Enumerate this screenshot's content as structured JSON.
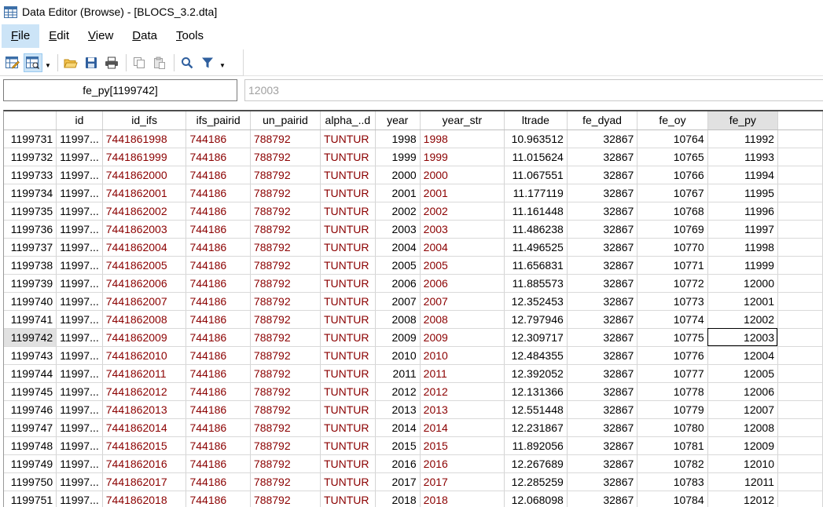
{
  "window": {
    "title": "Data Editor (Browse) - [BLOCS_3.2.dta]",
    "app_icon": "spreadsheet-icon"
  },
  "menu": [
    {
      "label": "File",
      "key": "F",
      "rest": "ile",
      "active": true
    },
    {
      "label": "Edit",
      "key": "E",
      "rest": "dit",
      "active": false
    },
    {
      "label": "View",
      "key": "V",
      "rest": "iew",
      "active": false
    },
    {
      "label": "Data",
      "key": "D",
      "rest": "ata",
      "active": false
    },
    {
      "label": "Tools",
      "key": "T",
      "rest": "ools",
      "active": false
    }
  ],
  "toolbar": {
    "icons": [
      "data-editor-edit-icon",
      "data-editor-browse-icon",
      "open-folder-icon",
      "save-icon",
      "print-icon",
      "copy-icon",
      "paste-icon",
      "find-icon",
      "filter-icon"
    ]
  },
  "varbar": {
    "cell_ref": "fe_py[1199742]",
    "cell_value": "12003"
  },
  "colors": {
    "string_text": "#8b0000",
    "selection": "#cce4f7",
    "frozen_divider": "#e02020"
  },
  "grid": {
    "columns": [
      {
        "key": "rownum",
        "label": "",
        "width": 67,
        "type": "rownum"
      },
      {
        "key": "id",
        "label": "id",
        "width": 53,
        "type": "id"
      },
      {
        "key": "id_ifs",
        "label": "id_ifs",
        "width": 108,
        "type": "str"
      },
      {
        "key": "ifs_pairid",
        "label": "ifs_pairid",
        "width": 83,
        "type": "str"
      },
      {
        "key": "un_pairid",
        "label": "un_pairid",
        "width": 91,
        "type": "str"
      },
      {
        "key": "alpha_d",
        "label": "alpha_..d",
        "width": 70,
        "type": "str"
      },
      {
        "key": "year",
        "label": "year",
        "width": 58,
        "type": "num"
      },
      {
        "key": "year_str",
        "label": "year_str",
        "width": 111,
        "type": "str",
        "frozen": true
      },
      {
        "key": "ltrade",
        "label": "ltrade",
        "width": 80,
        "type": "num"
      },
      {
        "key": "fe_dyad",
        "label": "fe_dyad",
        "width": 92,
        "type": "num"
      },
      {
        "key": "fe_oy",
        "label": "fe_oy",
        "width": 92,
        "type": "num"
      },
      {
        "key": "fe_py",
        "label": "fe_py",
        "width": 92,
        "type": "num",
        "selected": true
      },
      {
        "key": "extra",
        "label": "",
        "width": 60,
        "type": "blank"
      }
    ],
    "selected_row": "1199742",
    "selected_col": "fe_py",
    "rows": [
      {
        "rownum": "1199731",
        "id": "11997...",
        "id_ifs": "7441861998",
        "ifs_pairid": "744186",
        "un_pairid": "788792",
        "alpha_d": "TUNTUR",
        "year": "1998",
        "year_str": "1998",
        "ltrade": "10.963512",
        "fe_dyad": "32867",
        "fe_oy": "10764",
        "fe_py": "11992"
      },
      {
        "rownum": "1199732",
        "id": "11997...",
        "id_ifs": "7441861999",
        "ifs_pairid": "744186",
        "un_pairid": "788792",
        "alpha_d": "TUNTUR",
        "year": "1999",
        "year_str": "1999",
        "ltrade": "11.015624",
        "fe_dyad": "32867",
        "fe_oy": "10765",
        "fe_py": "11993"
      },
      {
        "rownum": "1199733",
        "id": "11997...",
        "id_ifs": "7441862000",
        "ifs_pairid": "744186",
        "un_pairid": "788792",
        "alpha_d": "TUNTUR",
        "year": "2000",
        "year_str": "2000",
        "ltrade": "11.067551",
        "fe_dyad": "32867",
        "fe_oy": "10766",
        "fe_py": "11994"
      },
      {
        "rownum": "1199734",
        "id": "11997...",
        "id_ifs": "7441862001",
        "ifs_pairid": "744186",
        "un_pairid": "788792",
        "alpha_d": "TUNTUR",
        "year": "2001",
        "year_str": "2001",
        "ltrade": "11.177119",
        "fe_dyad": "32867",
        "fe_oy": "10767",
        "fe_py": "11995"
      },
      {
        "rownum": "1199735",
        "id": "11997...",
        "id_ifs": "7441862002",
        "ifs_pairid": "744186",
        "un_pairid": "788792",
        "alpha_d": "TUNTUR",
        "year": "2002",
        "year_str": "2002",
        "ltrade": "11.161448",
        "fe_dyad": "32867",
        "fe_oy": "10768",
        "fe_py": "11996"
      },
      {
        "rownum": "1199736",
        "id": "11997...",
        "id_ifs": "7441862003",
        "ifs_pairid": "744186",
        "un_pairid": "788792",
        "alpha_d": "TUNTUR",
        "year": "2003",
        "year_str": "2003",
        "ltrade": "11.486238",
        "fe_dyad": "32867",
        "fe_oy": "10769",
        "fe_py": "11997"
      },
      {
        "rownum": "1199737",
        "id": "11997...",
        "id_ifs": "7441862004",
        "ifs_pairid": "744186",
        "un_pairid": "788792",
        "alpha_d": "TUNTUR",
        "year": "2004",
        "year_str": "2004",
        "ltrade": "11.496525",
        "fe_dyad": "32867",
        "fe_oy": "10770",
        "fe_py": "11998"
      },
      {
        "rownum": "1199738",
        "id": "11997...",
        "id_ifs": "7441862005",
        "ifs_pairid": "744186",
        "un_pairid": "788792",
        "alpha_d": "TUNTUR",
        "year": "2005",
        "year_str": "2005",
        "ltrade": "11.656831",
        "fe_dyad": "32867",
        "fe_oy": "10771",
        "fe_py": "11999"
      },
      {
        "rownum": "1199739",
        "id": "11997...",
        "id_ifs": "7441862006",
        "ifs_pairid": "744186",
        "un_pairid": "788792",
        "alpha_d": "TUNTUR",
        "year": "2006",
        "year_str": "2006",
        "ltrade": "11.885573",
        "fe_dyad": "32867",
        "fe_oy": "10772",
        "fe_py": "12000"
      },
      {
        "rownum": "1199740",
        "id": "11997...",
        "id_ifs": "7441862007",
        "ifs_pairid": "744186",
        "un_pairid": "788792",
        "alpha_d": "TUNTUR",
        "year": "2007",
        "year_str": "2007",
        "ltrade": "12.352453",
        "fe_dyad": "32867",
        "fe_oy": "10773",
        "fe_py": "12001"
      },
      {
        "rownum": "1199741",
        "id": "11997...",
        "id_ifs": "7441862008",
        "ifs_pairid": "744186",
        "un_pairid": "788792",
        "alpha_d": "TUNTUR",
        "year": "2008",
        "year_str": "2008",
        "ltrade": "12.797946",
        "fe_dyad": "32867",
        "fe_oy": "10774",
        "fe_py": "12002"
      },
      {
        "rownum": "1199742",
        "id": "11997...",
        "id_ifs": "7441862009",
        "ifs_pairid": "744186",
        "un_pairid": "788792",
        "alpha_d": "TUNTUR",
        "year": "2009",
        "year_str": "2009",
        "ltrade": "12.309717",
        "fe_dyad": "32867",
        "fe_oy": "10775",
        "fe_py": "12003"
      },
      {
        "rownum": "1199743",
        "id": "11997...",
        "id_ifs": "7441862010",
        "ifs_pairid": "744186",
        "un_pairid": "788792",
        "alpha_d": "TUNTUR",
        "year": "2010",
        "year_str": "2010",
        "ltrade": "12.484355",
        "fe_dyad": "32867",
        "fe_oy": "10776",
        "fe_py": "12004"
      },
      {
        "rownum": "1199744",
        "id": "11997...",
        "id_ifs": "7441862011",
        "ifs_pairid": "744186",
        "un_pairid": "788792",
        "alpha_d": "TUNTUR",
        "year": "2011",
        "year_str": "2011",
        "ltrade": "12.392052",
        "fe_dyad": "32867",
        "fe_oy": "10777",
        "fe_py": "12005"
      },
      {
        "rownum": "1199745",
        "id": "11997...",
        "id_ifs": "7441862012",
        "ifs_pairid": "744186",
        "un_pairid": "788792",
        "alpha_d": "TUNTUR",
        "year": "2012",
        "year_str": "2012",
        "ltrade": "12.131366",
        "fe_dyad": "32867",
        "fe_oy": "10778",
        "fe_py": "12006"
      },
      {
        "rownum": "1199746",
        "id": "11997...",
        "id_ifs": "7441862013",
        "ifs_pairid": "744186",
        "un_pairid": "788792",
        "alpha_d": "TUNTUR",
        "year": "2013",
        "year_str": "2013",
        "ltrade": "12.551448",
        "fe_dyad": "32867",
        "fe_oy": "10779",
        "fe_py": "12007"
      },
      {
        "rownum": "1199747",
        "id": "11997...",
        "id_ifs": "7441862014",
        "ifs_pairid": "744186",
        "un_pairid": "788792",
        "alpha_d": "TUNTUR",
        "year": "2014",
        "year_str": "2014",
        "ltrade": "12.231867",
        "fe_dyad": "32867",
        "fe_oy": "10780",
        "fe_py": "12008"
      },
      {
        "rownum": "1199748",
        "id": "11997...",
        "id_ifs": "7441862015",
        "ifs_pairid": "744186",
        "un_pairid": "788792",
        "alpha_d": "TUNTUR",
        "year": "2015",
        "year_str": "2015",
        "ltrade": "11.892056",
        "fe_dyad": "32867",
        "fe_oy": "10781",
        "fe_py": "12009"
      },
      {
        "rownum": "1199749",
        "id": "11997...",
        "id_ifs": "7441862016",
        "ifs_pairid": "744186",
        "un_pairid": "788792",
        "alpha_d": "TUNTUR",
        "year": "2016",
        "year_str": "2016",
        "ltrade": "12.267689",
        "fe_dyad": "32867",
        "fe_oy": "10782",
        "fe_py": "12010"
      },
      {
        "rownum": "1199750",
        "id": "11997...",
        "id_ifs": "7441862017",
        "ifs_pairid": "744186",
        "un_pairid": "788792",
        "alpha_d": "TUNTUR",
        "year": "2017",
        "year_str": "2017",
        "ltrade": "12.285259",
        "fe_dyad": "32867",
        "fe_oy": "10783",
        "fe_py": "12011"
      },
      {
        "rownum": "1199751",
        "id": "11997...",
        "id_ifs": "7441862018",
        "ifs_pairid": "744186",
        "un_pairid": "788792",
        "alpha_d": "TUNTUR",
        "year": "2018",
        "year_str": "2018",
        "ltrade": "12.068098",
        "fe_dyad": "32867",
        "fe_oy": "10784",
        "fe_py": "12012"
      }
    ]
  }
}
